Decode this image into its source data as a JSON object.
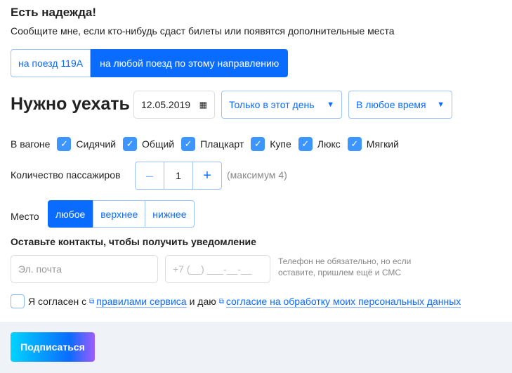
{
  "title": "Есть надежда!",
  "subtitle": "Сообщите мне, если кто-нибудь сдаст билеты или появятся дополнительные места",
  "train_toggle": {
    "option_1": "на поезд 119А",
    "option_2": "на любой поезд по этому направлению"
  },
  "heading": "Нужно уехать",
  "date": "12.05.2019",
  "day_select": "Только в этот день",
  "time_select": "В любое время",
  "car_label": "В вагоне",
  "car_types": [
    "Сидячий",
    "Общий",
    "Плацкарт",
    "Купе",
    "Люкс",
    "Мягкий"
  ],
  "passengers": {
    "label": "Количество пассажиров",
    "minus": "–",
    "value": "1",
    "plus": "+",
    "note": "(максимум 4)"
  },
  "seat": {
    "label": "Место",
    "options": [
      "любое",
      "верхнее",
      "нижнее"
    ]
  },
  "contacts_title": "Оставьте контакты, чтобы получить уведомление",
  "email_placeholder": "Эл. почта",
  "phone_placeholder": "+7 (__) ___-__-__",
  "phone_hint": "Телефон не обязательно, но если оставите, пришлем ещё и СМС",
  "agree": {
    "prefix": "Я согласен с",
    "link1": "правилами сервиса",
    "middle": "и даю",
    "link2": "согласие на обработку моих персональных данных"
  },
  "subscribe": "Подписаться"
}
